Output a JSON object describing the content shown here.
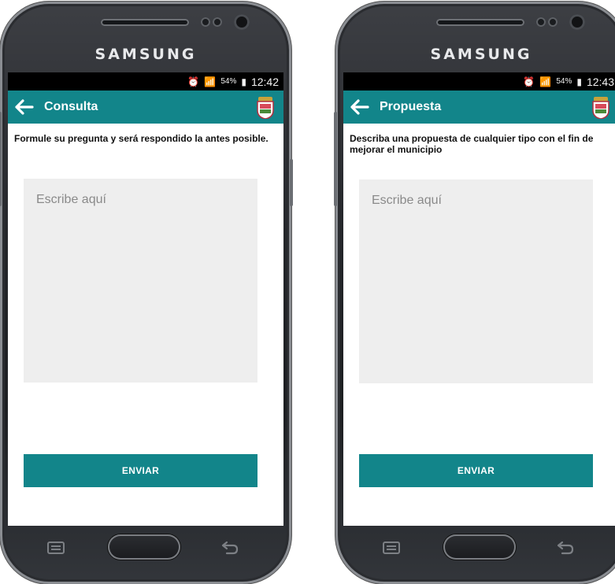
{
  "phones": [
    {
      "brand": "SAMSUNG",
      "status": {
        "time": "12:42",
        "battery": "54%"
      },
      "appbar": {
        "title": "Consulta",
        "back_icon": "arrow-left-icon",
        "crest_icon": "municipal-crest-icon"
      },
      "description": "Formule su pregunta y será respondido la antes posible.",
      "input": {
        "placeholder": "Escribe aquí",
        "value": ""
      },
      "send_label": "ENVIAR"
    },
    {
      "brand": "SAMSUNG",
      "status": {
        "time": "12:43",
        "battery": "54%"
      },
      "appbar": {
        "title": "Propuesta",
        "back_icon": "arrow-left-icon",
        "crest_icon": "municipal-crest-icon"
      },
      "description": "Describa una propuesta de cualquier tipo con el fin de mejorar el municipio",
      "input": {
        "placeholder": "Escribe aquí",
        "value": ""
      },
      "send_label": "ENVIAR"
    }
  ],
  "colors": {
    "accent": "#12858a",
    "input_bg": "#eeeeee",
    "status_bar": "#000000"
  }
}
